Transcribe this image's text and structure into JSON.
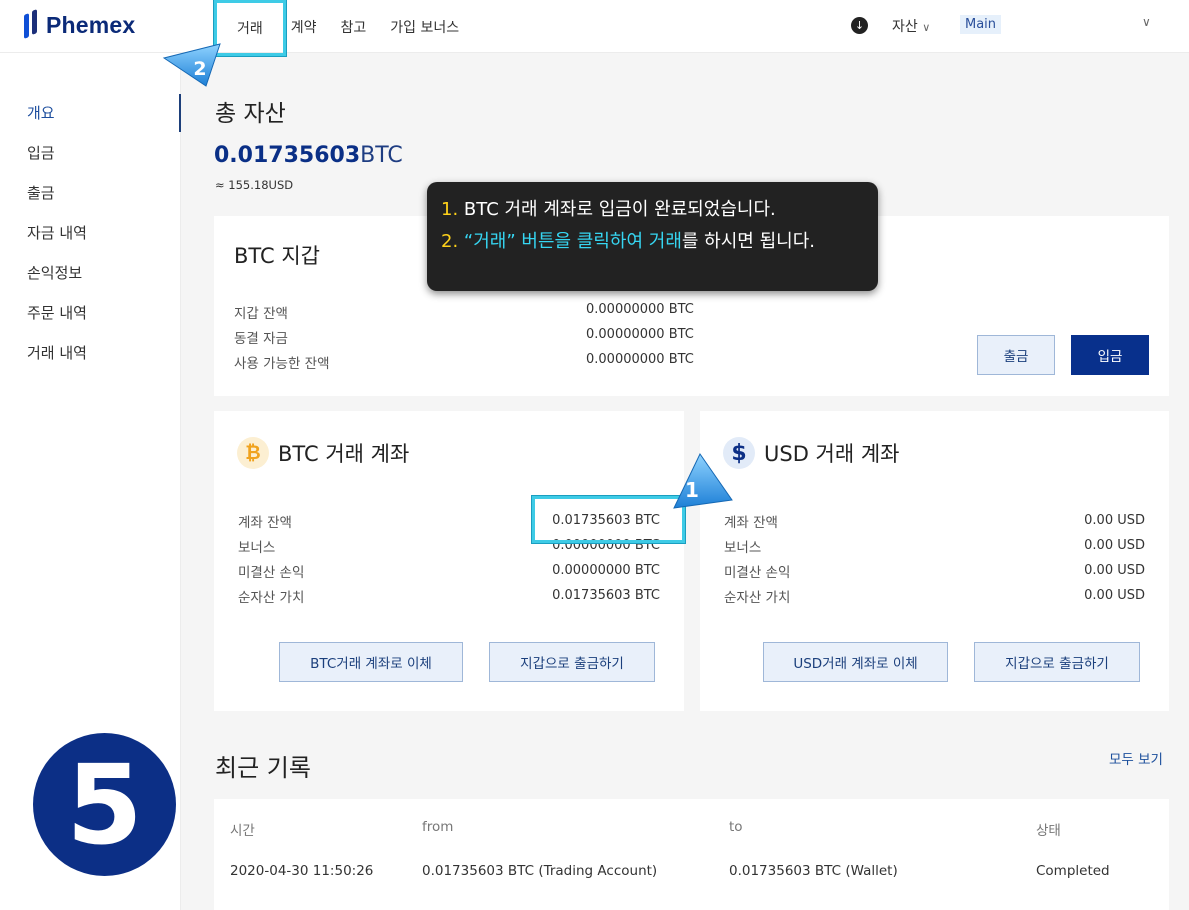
{
  "app": {
    "logo_text": "Phemex",
    "brand_color": "#0b2a78"
  },
  "topnav": {
    "items": [
      {
        "label": "거래"
      },
      {
        "label": "계약"
      },
      {
        "label": "참고"
      },
      {
        "label": "가입 보너스"
      }
    ],
    "asset_menu": "자산",
    "account_tag": "Main",
    "chevron": "⌄"
  },
  "sidebar": {
    "items": [
      {
        "label": "개요"
      },
      {
        "label": "입금"
      },
      {
        "label": "출금"
      },
      {
        "label": "자금 내역"
      },
      {
        "label": "손익정보"
      },
      {
        "label": "주문 내역"
      },
      {
        "label": "거래 내역"
      }
    ]
  },
  "overview": {
    "title": "총 자산",
    "total_btc_value": "0.01735603",
    "total_btc_unit": "BTC",
    "total_usd": "≈ 155.18USD"
  },
  "wallet": {
    "title": "BTC 지갑",
    "rows": [
      {
        "label": "지갑 잔액",
        "value": "0.00000000 BTC"
      },
      {
        "label": "동결 자금",
        "value": "0.00000000 BTC"
      },
      {
        "label": "사용 가능한 잔액",
        "value": "0.00000000 BTC"
      }
    ],
    "withdraw_label": "출금",
    "deposit_label": "입금"
  },
  "btc_account": {
    "title": "BTC 거래 계좌",
    "icon_glyph": "₿",
    "rows": [
      {
        "label": "계좌 잔액",
        "value": "0.01735603 BTC"
      },
      {
        "label": "보너스",
        "value": "0.00000000 BTC"
      },
      {
        "label": "미결산 손익",
        "value": "0.00000000 BTC"
      },
      {
        "label": "순자산 가치",
        "value": "0.01735603 BTC"
      }
    ],
    "transfer_label": "BTC거래 계좌로 이체",
    "withdraw_label": "지갑으로 출금하기"
  },
  "usd_account": {
    "title": "USD 거래 계좌",
    "icon_glyph": "$",
    "rows": [
      {
        "label": "계좌 잔액",
        "value": "0.00 USD"
      },
      {
        "label": "보너스",
        "value": "0.00 USD"
      },
      {
        "label": "미결산 손익",
        "value": "0.00 USD"
      },
      {
        "label": "순자산 가치",
        "value": "0.00 USD"
      }
    ],
    "transfer_label": "USD거래 계좌로 이체",
    "withdraw_label": "지갑으로 출금하기"
  },
  "annotation": {
    "line1_num": "1.",
    "line1_text": " BTC 거래 계좌로 입금이 완료되었습니다.",
    "line2_num": "2.",
    "line2_quote": " “거래” 버튼을 클릭하여 거래",
    "line2_rest": "를 하시면 됩니다.",
    "badge1": "1",
    "badge2": "2",
    "step_number": "5"
  },
  "recent": {
    "title": "최근 기록",
    "see_all": "모두 보기",
    "columns": [
      "시간",
      "from",
      "to",
      "상태"
    ],
    "rows": [
      {
        "time": "2020-04-30 11:50:26",
        "from": "0.01735603 BTC (Trading Account)",
        "to": "0.01735603 BTC (Wallet)",
        "status": "Completed"
      }
    ]
  }
}
